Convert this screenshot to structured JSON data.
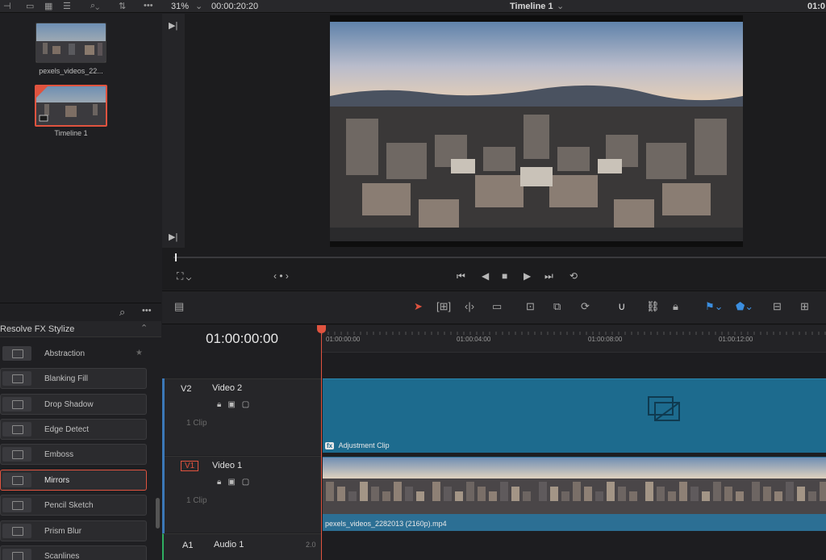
{
  "topbar": {
    "zoom": "31%",
    "timecode": "00:00:20:20",
    "timeline_title": "Timeline 1",
    "right_timecode": "01:0"
  },
  "media_pool": {
    "clips": [
      {
        "label": "pexels_videos_22..."
      },
      {
        "label": "Timeline 1"
      }
    ]
  },
  "effects": {
    "category": "Resolve FX Stylize",
    "items": [
      {
        "label": "Abstraction"
      },
      {
        "label": "Blanking Fill"
      },
      {
        "label": "Drop Shadow"
      },
      {
        "label": "Edge Detect"
      },
      {
        "label": "Emboss"
      },
      {
        "label": "Mirrors"
      },
      {
        "label": "Pencil Sketch"
      },
      {
        "label": "Prism Blur"
      },
      {
        "label": "Scanlines"
      }
    ]
  },
  "timeline": {
    "timecode": "01:00:00:00",
    "ruler": [
      "01:00:00:00",
      "01:00:04:00",
      "01:00:08:00",
      "01:00:12:00"
    ],
    "tracks": [
      {
        "id": "V2",
        "name": "Video 2",
        "clips": "1 Clip"
      },
      {
        "id": "V1",
        "name": "Video 1",
        "clips": "1 Clip"
      },
      {
        "id": "A1",
        "name": "Audio 1",
        "level": "2.0"
      }
    ],
    "adjustment_clip": "Adjustment Clip",
    "video_clip": "pexels_videos_2282013 (2160p).mp4"
  },
  "colors": {
    "accent": "#e0533f",
    "adjustment_clip": "#1d6b8e",
    "video_clip": "#2c6f94"
  }
}
